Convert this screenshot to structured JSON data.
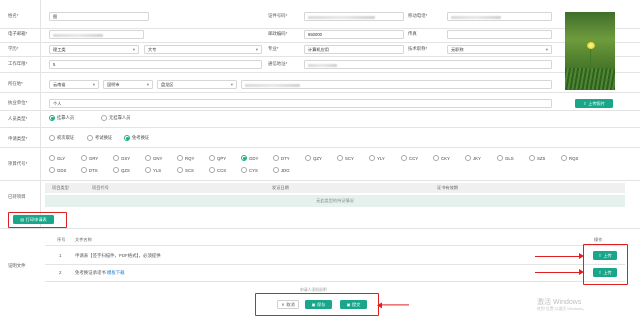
{
  "form": {
    "name_label": "姓名*",
    "name_value": "图",
    "idcard_label": "证件号码*",
    "phone_label": "移动电话*",
    "email_label": "电子邮箱*",
    "postcode_label": "邮政编码*",
    "postcode_value": "650000",
    "fax_label": "传真",
    "education_label": "学历*",
    "education_value": "理工类",
    "education_sub": "大专",
    "major_label": "专业*",
    "major_value": "计算机应用",
    "title_label": "技术职称*",
    "title_value": "无职称",
    "work_years_label": "工作年限*",
    "work_years_value": "5",
    "address_label": "通信地址*",
    "location_label": "所在地*",
    "province": "云南省",
    "city": "昆明市",
    "district": "盘龙区",
    "unit_label": "执业单位*",
    "unit_value": "个人",
    "person_type_label": "人员类型*",
    "person_types": [
      "挂靠人员",
      "无挂靠人员"
    ],
    "apply_type_label": "申请类型*",
    "apply_types": [
      "初次取证",
      "考试换证",
      "免考换证"
    ],
    "project_code_label": "项目代号*",
    "project_codes_row1": [
      "GLY",
      "GRY",
      "GSY",
      "GNY",
      "RQY",
      "QPY",
      "GDY",
      "DTY",
      "QZY",
      "SCY",
      "YLY",
      "CCY",
      "CKY",
      "JKY",
      "GLS",
      "SZS",
      "RQS"
    ],
    "project_codes_row2": [
      "GDS",
      "DTS",
      "QZS",
      "YLS",
      "SCS",
      "CCS",
      "CYS",
      "JDG"
    ],
    "cert_items_label": "已持项目",
    "cert_headers": [
      "项目类型",
      "项目代号",
      "发证日期",
      "证书有效期"
    ],
    "cert_empty": "无此类型的持证情况",
    "print_button": "打印申请表",
    "docs_label": "证明文件",
    "docs_headers": [
      "序号",
      "文件名称",
      "操作"
    ],
    "docs": [
      {
        "no": "1",
        "name": "申请表【签字扫描件，PDF格式】，必须提供",
        "link": ""
      },
      {
        "no": "2",
        "name": "免考换证承诺书",
        "link": "模板下载"
      }
    ],
    "upload_label": "上传",
    "photo_caption": "",
    "photo_upload": "上传照片",
    "notice": "申请人须知说明",
    "buttons": {
      "cancel": "取消",
      "save": "保存",
      "submit": "提交"
    }
  },
  "watermark": {
    "title": "激活 Windows",
    "sub": "转到“设置”以激活 Windows。"
  },
  "colors": {
    "accent": "#1aa68a",
    "annotation": "#e02020",
    "table_empty_bg": "#e4f1ec"
  }
}
